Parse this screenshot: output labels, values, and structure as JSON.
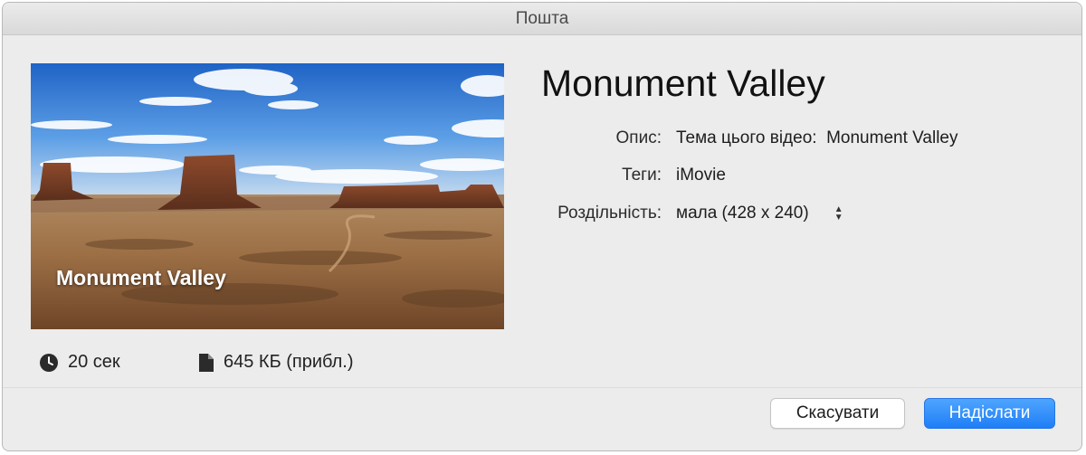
{
  "window": {
    "title": "Пошта"
  },
  "thumbnail": {
    "caption": "Monument Valley"
  },
  "meta": {
    "duration": "20 сек",
    "duration_icon": "clock-icon",
    "file_size": "645 КБ (прибл.)",
    "file_icon": "document-icon"
  },
  "details": {
    "title": "Monument Valley",
    "description_label": "Опис:",
    "description_value": "Тема цього відео:  Monument Valley",
    "tags_label": "Теги:",
    "tags_value": "iMovie",
    "resolution_label": "Роздільність:",
    "resolution_value": "мала (428 x 240)"
  },
  "buttons": {
    "cancel": "Скасувати",
    "send": "Надіслати"
  },
  "colors": {
    "accent": "#1e7ef6",
    "window_bg": "#ececec"
  }
}
